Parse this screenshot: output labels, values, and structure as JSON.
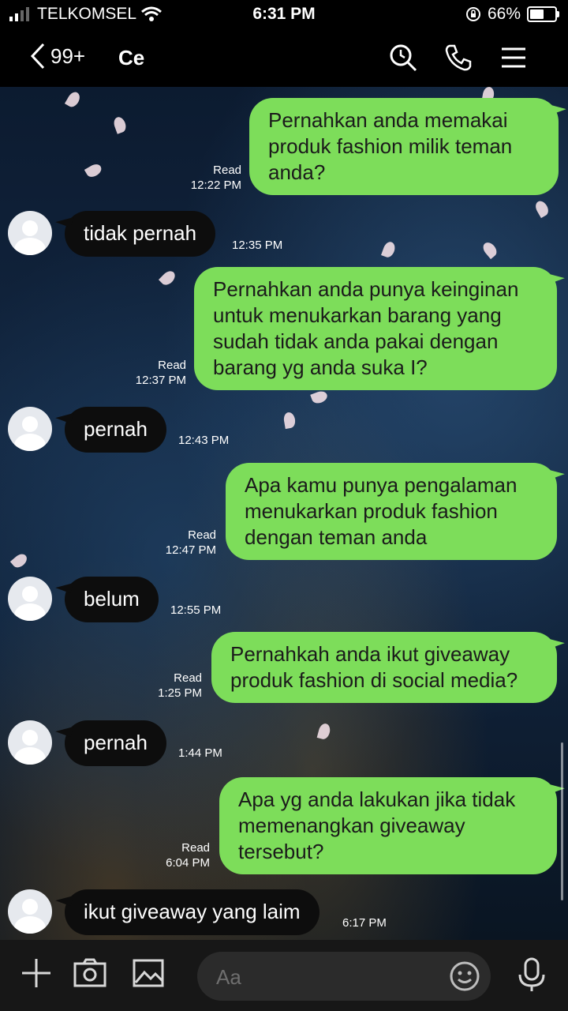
{
  "status": {
    "carrier": "TELKOMSEL",
    "time": "6:31 PM",
    "battery": "66%",
    "battery_level": 0.66
  },
  "header": {
    "back_count": "99+",
    "contact_name": "Ce",
    "icons": [
      "chevron-left-icon",
      "search-icon",
      "phone-icon",
      "menu-icon"
    ]
  },
  "messages": [
    {
      "side": "sent",
      "text": "Pernahkan anda memakai produk fashion milik teman anda?",
      "status": "Read",
      "time": "12:22 PM"
    },
    {
      "side": "received",
      "text": "tidak pernah",
      "time": "12:35 PM"
    },
    {
      "side": "sent",
      "text": "Pernahkan anda punya keinginan untuk menukarkan barang yang sudah tidak anda pakai dengan barang yg anda suka I?",
      "status": "Read",
      "time": "12:37 PM"
    },
    {
      "side": "received",
      "text": "pernah",
      "time": "12:43 PM"
    },
    {
      "side": "sent",
      "text": "Apa kamu punya pengalaman menukarkan produk fashion dengan teman anda",
      "status": "Read",
      "time": "12:47 PM"
    },
    {
      "side": "received",
      "text": "belum",
      "time": "12:55 PM"
    },
    {
      "side": "sent",
      "text": "Pernahkah anda ikut giveaway produk fashion di social media?",
      "status": "Read",
      "time": "1:25 PM"
    },
    {
      "side": "received",
      "text": "pernah",
      "time": "1:44 PM"
    },
    {
      "side": "sent",
      "text": "Apa yg anda lakukan jika tidak memenangkan giveaway tersebut?",
      "status": "Read",
      "time": "6:04 PM"
    },
    {
      "side": "received",
      "text": "ikut giveaway yang laim",
      "time": "6:17 PM"
    }
  ],
  "input": {
    "placeholder": "Aa"
  },
  "toolbar": {
    "icons": [
      "plus-icon",
      "camera-icon",
      "image-icon",
      "emoji-icon",
      "microphone-icon"
    ]
  },
  "colors": {
    "sent_bubble": "#7ddd5a",
    "received_bubble": "#0d0d0d",
    "bar": "#000000"
  }
}
